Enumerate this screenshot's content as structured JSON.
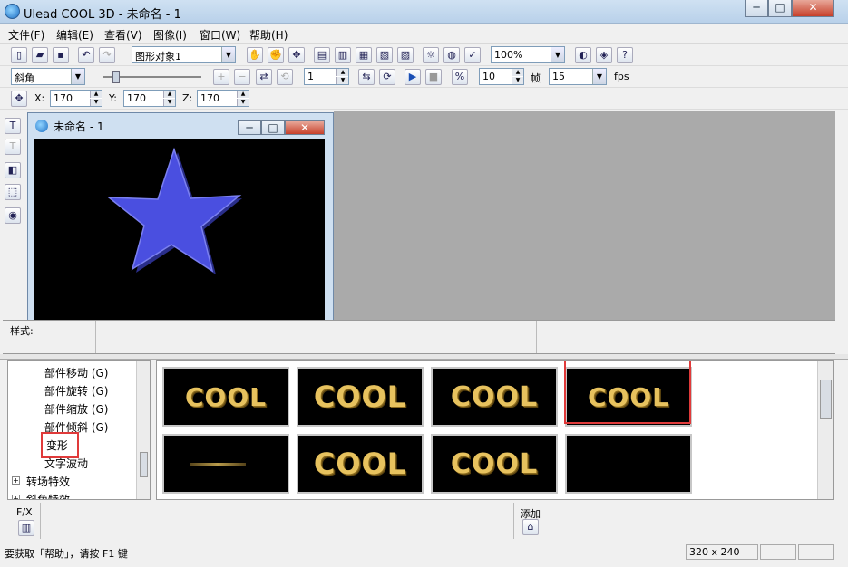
{
  "window": {
    "title": "Ulead COOL 3D - 未命名 - 1",
    "minimize": "─",
    "maximize": "□",
    "close": "✕"
  },
  "menu": [
    "文件(F)",
    "编辑(E)",
    "查看(V)",
    "图像(I)",
    "窗口(W)",
    "帮助(H)"
  ],
  "toolbar1": {
    "object_select": "图形对象1",
    "zoom": "100%"
  },
  "toolbar2": {
    "bevel_select": "斜角",
    "frame_value": "1",
    "frames_value": "10",
    "frame_label": "帧",
    "fps_value": "15",
    "fps_label": "fps"
  },
  "toolbar3": {
    "x_label": "X:",
    "x_value": "170",
    "y_label": "Y:",
    "y_value": "170",
    "z_label": "Z:",
    "z_value": "170"
  },
  "document": {
    "title": "未命名 - 1"
  },
  "style_panel": {
    "label": "样式:"
  },
  "tree": {
    "items": [
      "部件移动 (G)",
      "部件旋转 (G)",
      "部件缩放 (G)",
      "部件倾斜 (G)",
      "变形",
      "文字波动"
    ],
    "groups": [
      "转场特效",
      "斜角特效"
    ]
  },
  "thumbnails": {
    "text": "COOL"
  },
  "bottom": {
    "fx_label": "F/X",
    "add_label": "添加"
  },
  "status": {
    "help_text": "要获取「帮助」，请按 F1 键",
    "size": "320 x 240"
  },
  "colors": {
    "star": "#4a4fe0",
    "cool_text": "#e7c25e",
    "highlight": "#e03a3a"
  }
}
